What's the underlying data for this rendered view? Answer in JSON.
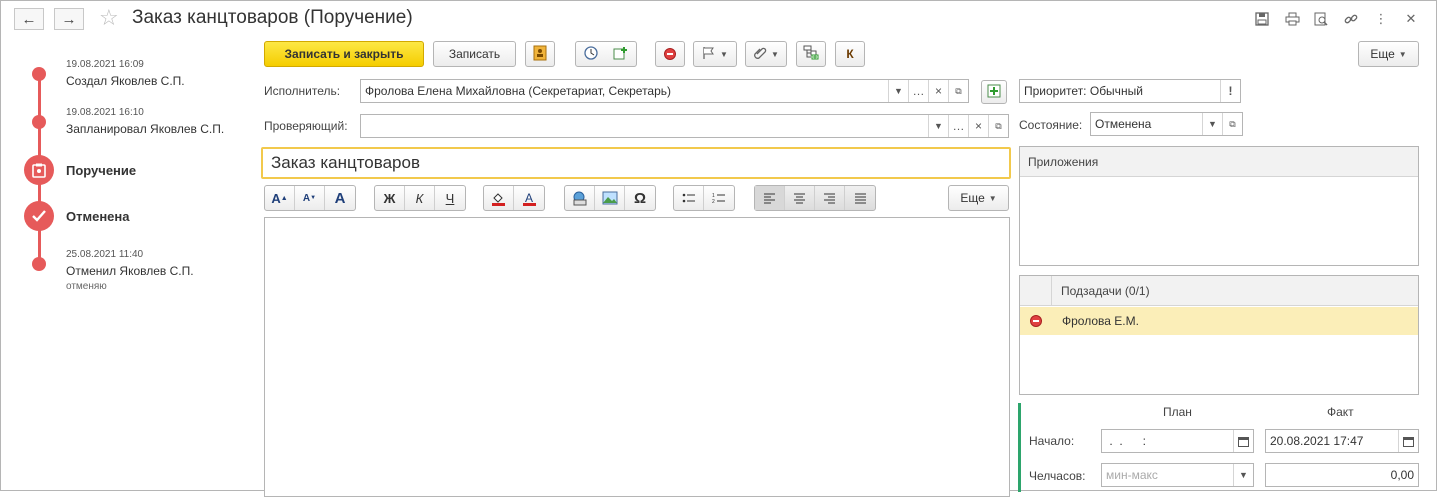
{
  "window": {
    "title": "Заказ канцтоваров (Поручение)",
    "back_icon": "←",
    "forward_icon": "→",
    "star_icon": "☆"
  },
  "timeline": {
    "created_date": "19.08.2021 16:09",
    "created_text": "Создал Яковлев С.П.",
    "planned_date": "19.08.2021 16:10",
    "planned_text": "Запланировал Яковлев С.П.",
    "task_label": "Поручение",
    "canceled_label": "Отменена",
    "cancel_date": "25.08.2021 11:40",
    "cancel_text": "Отменил Яковлев С.П.",
    "cancel_note": "отменяю"
  },
  "toolbar": {
    "save_close": "Записать и закрыть",
    "save": "Записать",
    "k_label": "К",
    "more": "Еще"
  },
  "form": {
    "executor_label": "Исполнитель:",
    "executor_value": "Фролова Елена Михайловна (Секретариат, Секретарь)",
    "reviewer_label": "Проверяющий:",
    "reviewer_value": "",
    "priority_value": "Приоритет: Обычный",
    "state_label": "Состояние:",
    "state_value": "Отменена",
    "subject": "Заказ канцтоваров"
  },
  "formatting": {
    "bold": "Ж",
    "italic": "К",
    "underline": "Ч",
    "omega": "Ω",
    "more": "Еще"
  },
  "attachments": {
    "header": "Приложения"
  },
  "subtasks": {
    "header": "Подзадачи (0/1)",
    "rows": [
      {
        "name": "Фролова Е.М."
      }
    ]
  },
  "schedule": {
    "plan_header": "План",
    "fact_header": "Факт",
    "start_label": "Начало:",
    "start_plan": " .  .      :",
    "start_fact": "20.08.2021 17:47",
    "hours_label": "Челчасов:",
    "hours_plan_placeholder": "мин-макс",
    "hours_fact": "0,00"
  }
}
